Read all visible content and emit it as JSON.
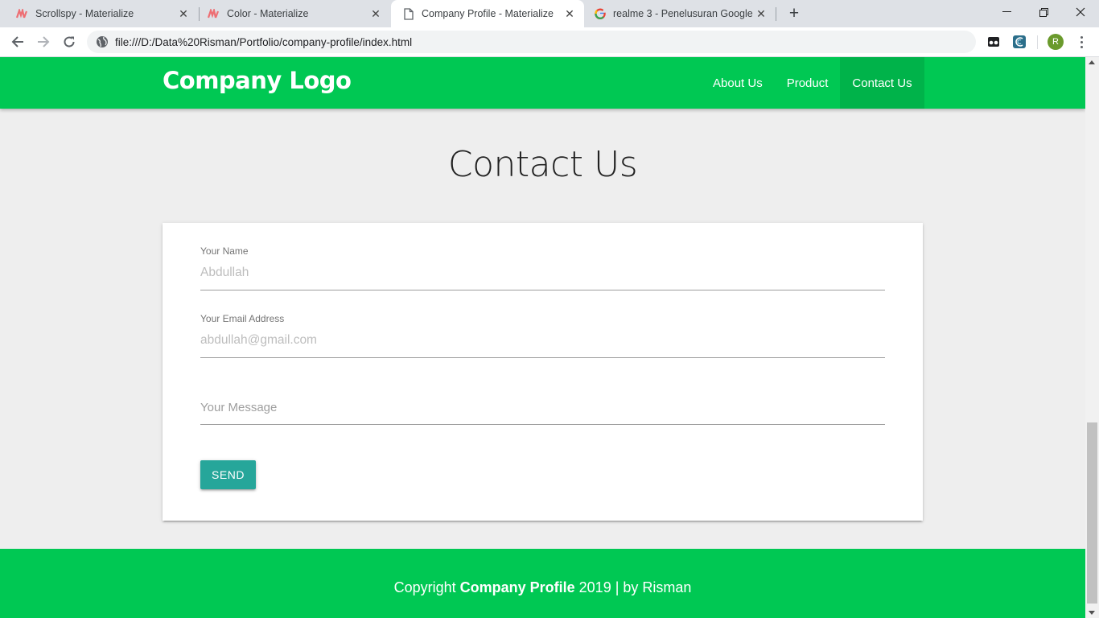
{
  "browser": {
    "tabs": [
      {
        "title": "Scrollspy - Materialize",
        "icon": "materialize-icon",
        "active": false
      },
      {
        "title": "Color - Materialize",
        "icon": "materialize-icon",
        "active": false
      },
      {
        "title": "Company Profile - Materialize",
        "icon": "document-icon",
        "active": true
      },
      {
        "title": "realme 3 - Penelusuran Google",
        "icon": "google-icon",
        "active": false
      }
    ],
    "new_tab_label": "+",
    "url": "file:///D:/Data%20Risman/Portfolio/company-profile/index.html",
    "profile_initial": "R",
    "colors": {
      "tabstrip": "#dee1e6",
      "avatar": "#6a9a2c"
    }
  },
  "navbar": {
    "brand": "Company Logo",
    "links": [
      {
        "label": "About Us",
        "active": false
      },
      {
        "label": "Product",
        "active": false
      },
      {
        "label": "Contact Us",
        "active": true
      }
    ],
    "color": "#00c853"
  },
  "section": {
    "title": "Contact Us"
  },
  "form": {
    "name_label": "Your Name",
    "name_placeholder": "Abdullah",
    "email_label": "Your Email Address",
    "email_placeholder": "abdullah@gmail.com",
    "message_placeholder": "Your Message",
    "send_label": "SEND",
    "button_color": "#26a69a"
  },
  "footer": {
    "prefix": "Copyright ",
    "company": "Company Profile",
    "suffix": " 2019 | by Risman",
    "color": "#00c853"
  }
}
